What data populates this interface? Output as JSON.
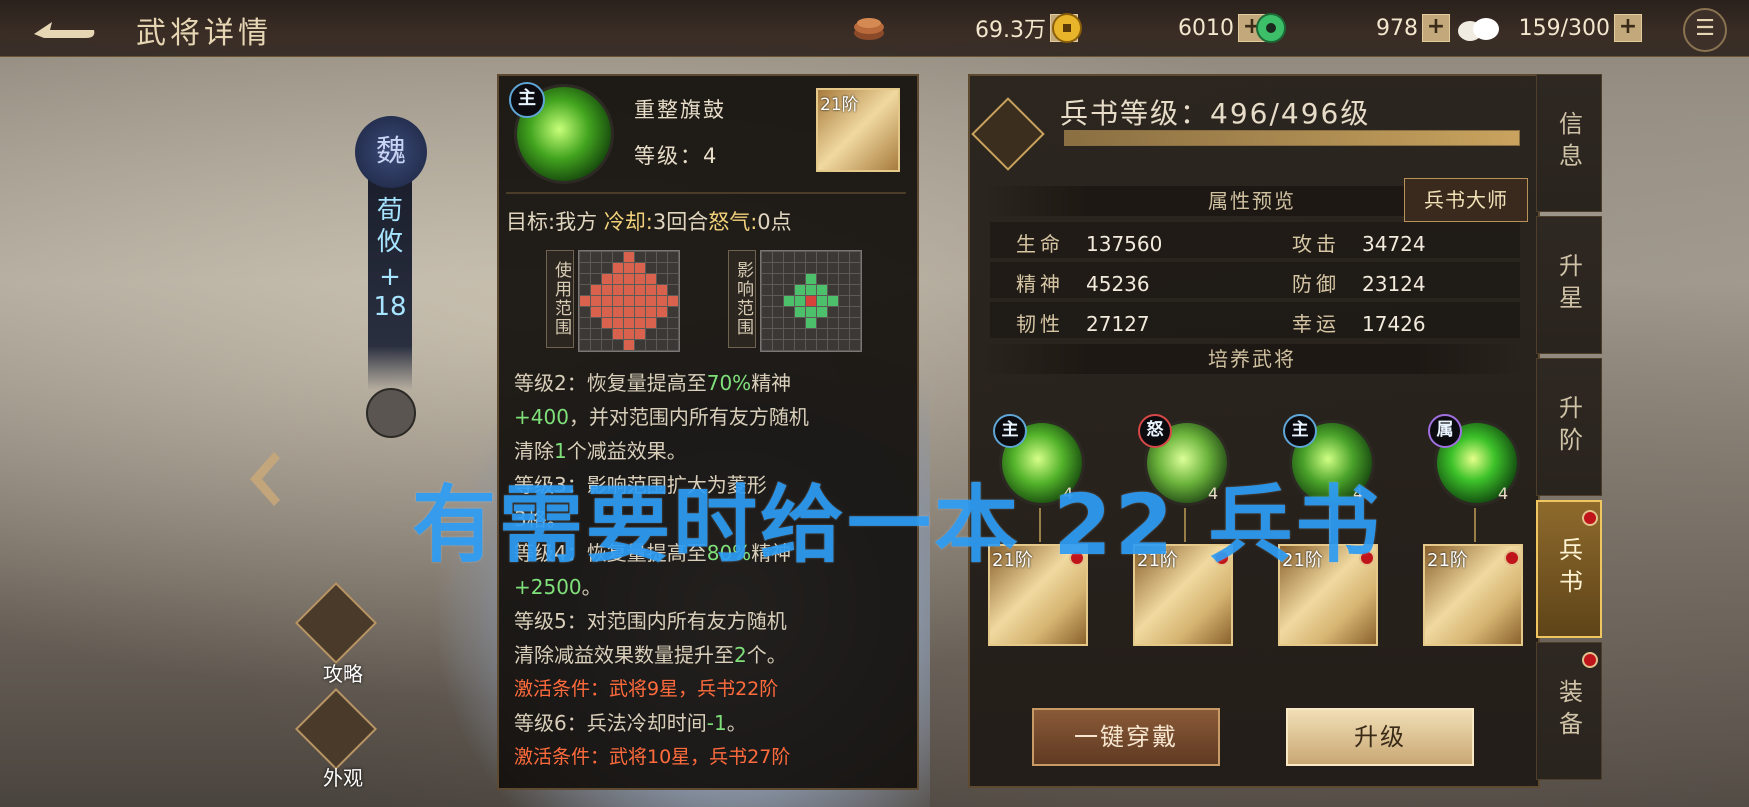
{
  "header": {
    "title": "武将详情",
    "resources": [
      {
        "icon": "copper-coins-icon",
        "value": "69.3万"
      },
      {
        "icon": "gold-coin-icon",
        "value": "6010"
      },
      {
        "icon": "jade-icon",
        "value": "978"
      },
      {
        "icon": "steamed-bun-stamina-icon",
        "value": "159/300"
      }
    ]
  },
  "hero": {
    "faction": "魏",
    "name": "荀攸",
    "stage": "+\n18"
  },
  "left_buttons": {
    "strategy": "攻略",
    "appearance": "外观"
  },
  "skill": {
    "type_tag": "主",
    "name": "重整旗鼓",
    "level": "等级：4",
    "book_tier": "21阶",
    "target_label": "目标:",
    "target_value": "我方",
    "cooldown_label": "冷却:",
    "cooldown_value": "3回合",
    "rage_label": "怒气:",
    "rage_value": "0点",
    "use_range_label": "使用范围",
    "effect_range_label": "影响范围",
    "description": [
      {
        "type": "text",
        "parts": [
          {
            "t": "等级2：恢复量提高至"
          },
          {
            "t": "70%",
            "num": true
          },
          {
            "t": "精神"
          }
        ]
      },
      {
        "type": "text",
        "parts": [
          {
            "t": "+400",
            "num": true
          },
          {
            "t": "，并对范围内所有友方随机"
          }
        ]
      },
      {
        "type": "text",
        "parts": [
          {
            "t": "清除"
          },
          {
            "t": "1",
            "num": true
          },
          {
            "t": "个减益效果。"
          }
        ]
      },
      {
        "type": "text",
        "parts": [
          {
            "t": "等级3：影响范围扩大为菱形"
          }
        ]
      },
      {
        "type": "text",
        "parts": [
          {
            "t": "3格。"
          }
        ]
      },
      {
        "type": "text",
        "parts": [
          {
            "t": "等级4：恢复量提高至"
          },
          {
            "t": "80%",
            "num": true
          },
          {
            "t": "精神"
          }
        ]
      },
      {
        "type": "text",
        "parts": [
          {
            "t": "+2500",
            "num": true
          },
          {
            "t": "。"
          }
        ]
      },
      {
        "type": "text",
        "parts": [
          {
            "t": "等级5：对范围内所有友方随机"
          }
        ]
      },
      {
        "type": "text",
        "parts": [
          {
            "t": "清除减益效果数量提升至"
          },
          {
            "t": "2",
            "num": true
          },
          {
            "t": "个。"
          }
        ]
      },
      {
        "type": "cond",
        "parts": [
          {
            "t": "激活条件：武将9星，兵书22阶"
          }
        ]
      },
      {
        "type": "text",
        "parts": [
          {
            "t": "等级6：兵法冷却时间"
          },
          {
            "t": "-1",
            "num": true
          },
          {
            "t": "。"
          }
        ]
      },
      {
        "type": "cond",
        "parts": [
          {
            "t": "激活条件：武将10星，兵书27阶"
          }
        ]
      }
    ]
  },
  "book_panel": {
    "level_text": "兵书等级：496/496级",
    "level_progress": 1.0,
    "attr_section": "属性预览",
    "master_button": "兵书大师",
    "stats": [
      {
        "k": "生命",
        "v": "137560"
      },
      {
        "k": "攻击",
        "v": "34724"
      },
      {
        "k": "精神",
        "v": "45236"
      },
      {
        "k": "防御",
        "v": "23124"
      },
      {
        "k": "韧性",
        "v": "27127"
      },
      {
        "k": "幸运",
        "v": "17426"
      }
    ],
    "cultivate_section": "培养武将",
    "slots": [
      {
        "tag": "主",
        "tag_color": "#5fa5d6",
        "level": "4",
        "tier": "21阶"
      },
      {
        "tag": "怒",
        "tag_color": "#d64848",
        "level": "4",
        "tier": "21阶"
      },
      {
        "tag": "主",
        "tag_color": "#5fa5d6",
        "level": "4",
        "tier": "21阶"
      },
      {
        "tag": "属",
        "tag_color": "#a070e0",
        "level": "4",
        "tier": "21阶"
      }
    ],
    "equip_all_button": "一键穿戴",
    "upgrade_button": "升级"
  },
  "tabs": [
    {
      "label": "信息",
      "active": false,
      "dot": false
    },
    {
      "label": "升星",
      "active": false,
      "dot": false
    },
    {
      "label": "升阶",
      "active": false,
      "dot": false
    },
    {
      "label": "兵书",
      "active": true,
      "dot": true
    },
    {
      "label": "装备",
      "active": false,
      "dot": true
    }
  ],
  "overlay_text": "有需要时给一本 22 兵书",
  "colors": {
    "accent_gold": "#c9a35e",
    "highlight_green": "#7fe07a",
    "condition_red": "#ff6b3c",
    "overlay_blue": "#2e9df5"
  }
}
